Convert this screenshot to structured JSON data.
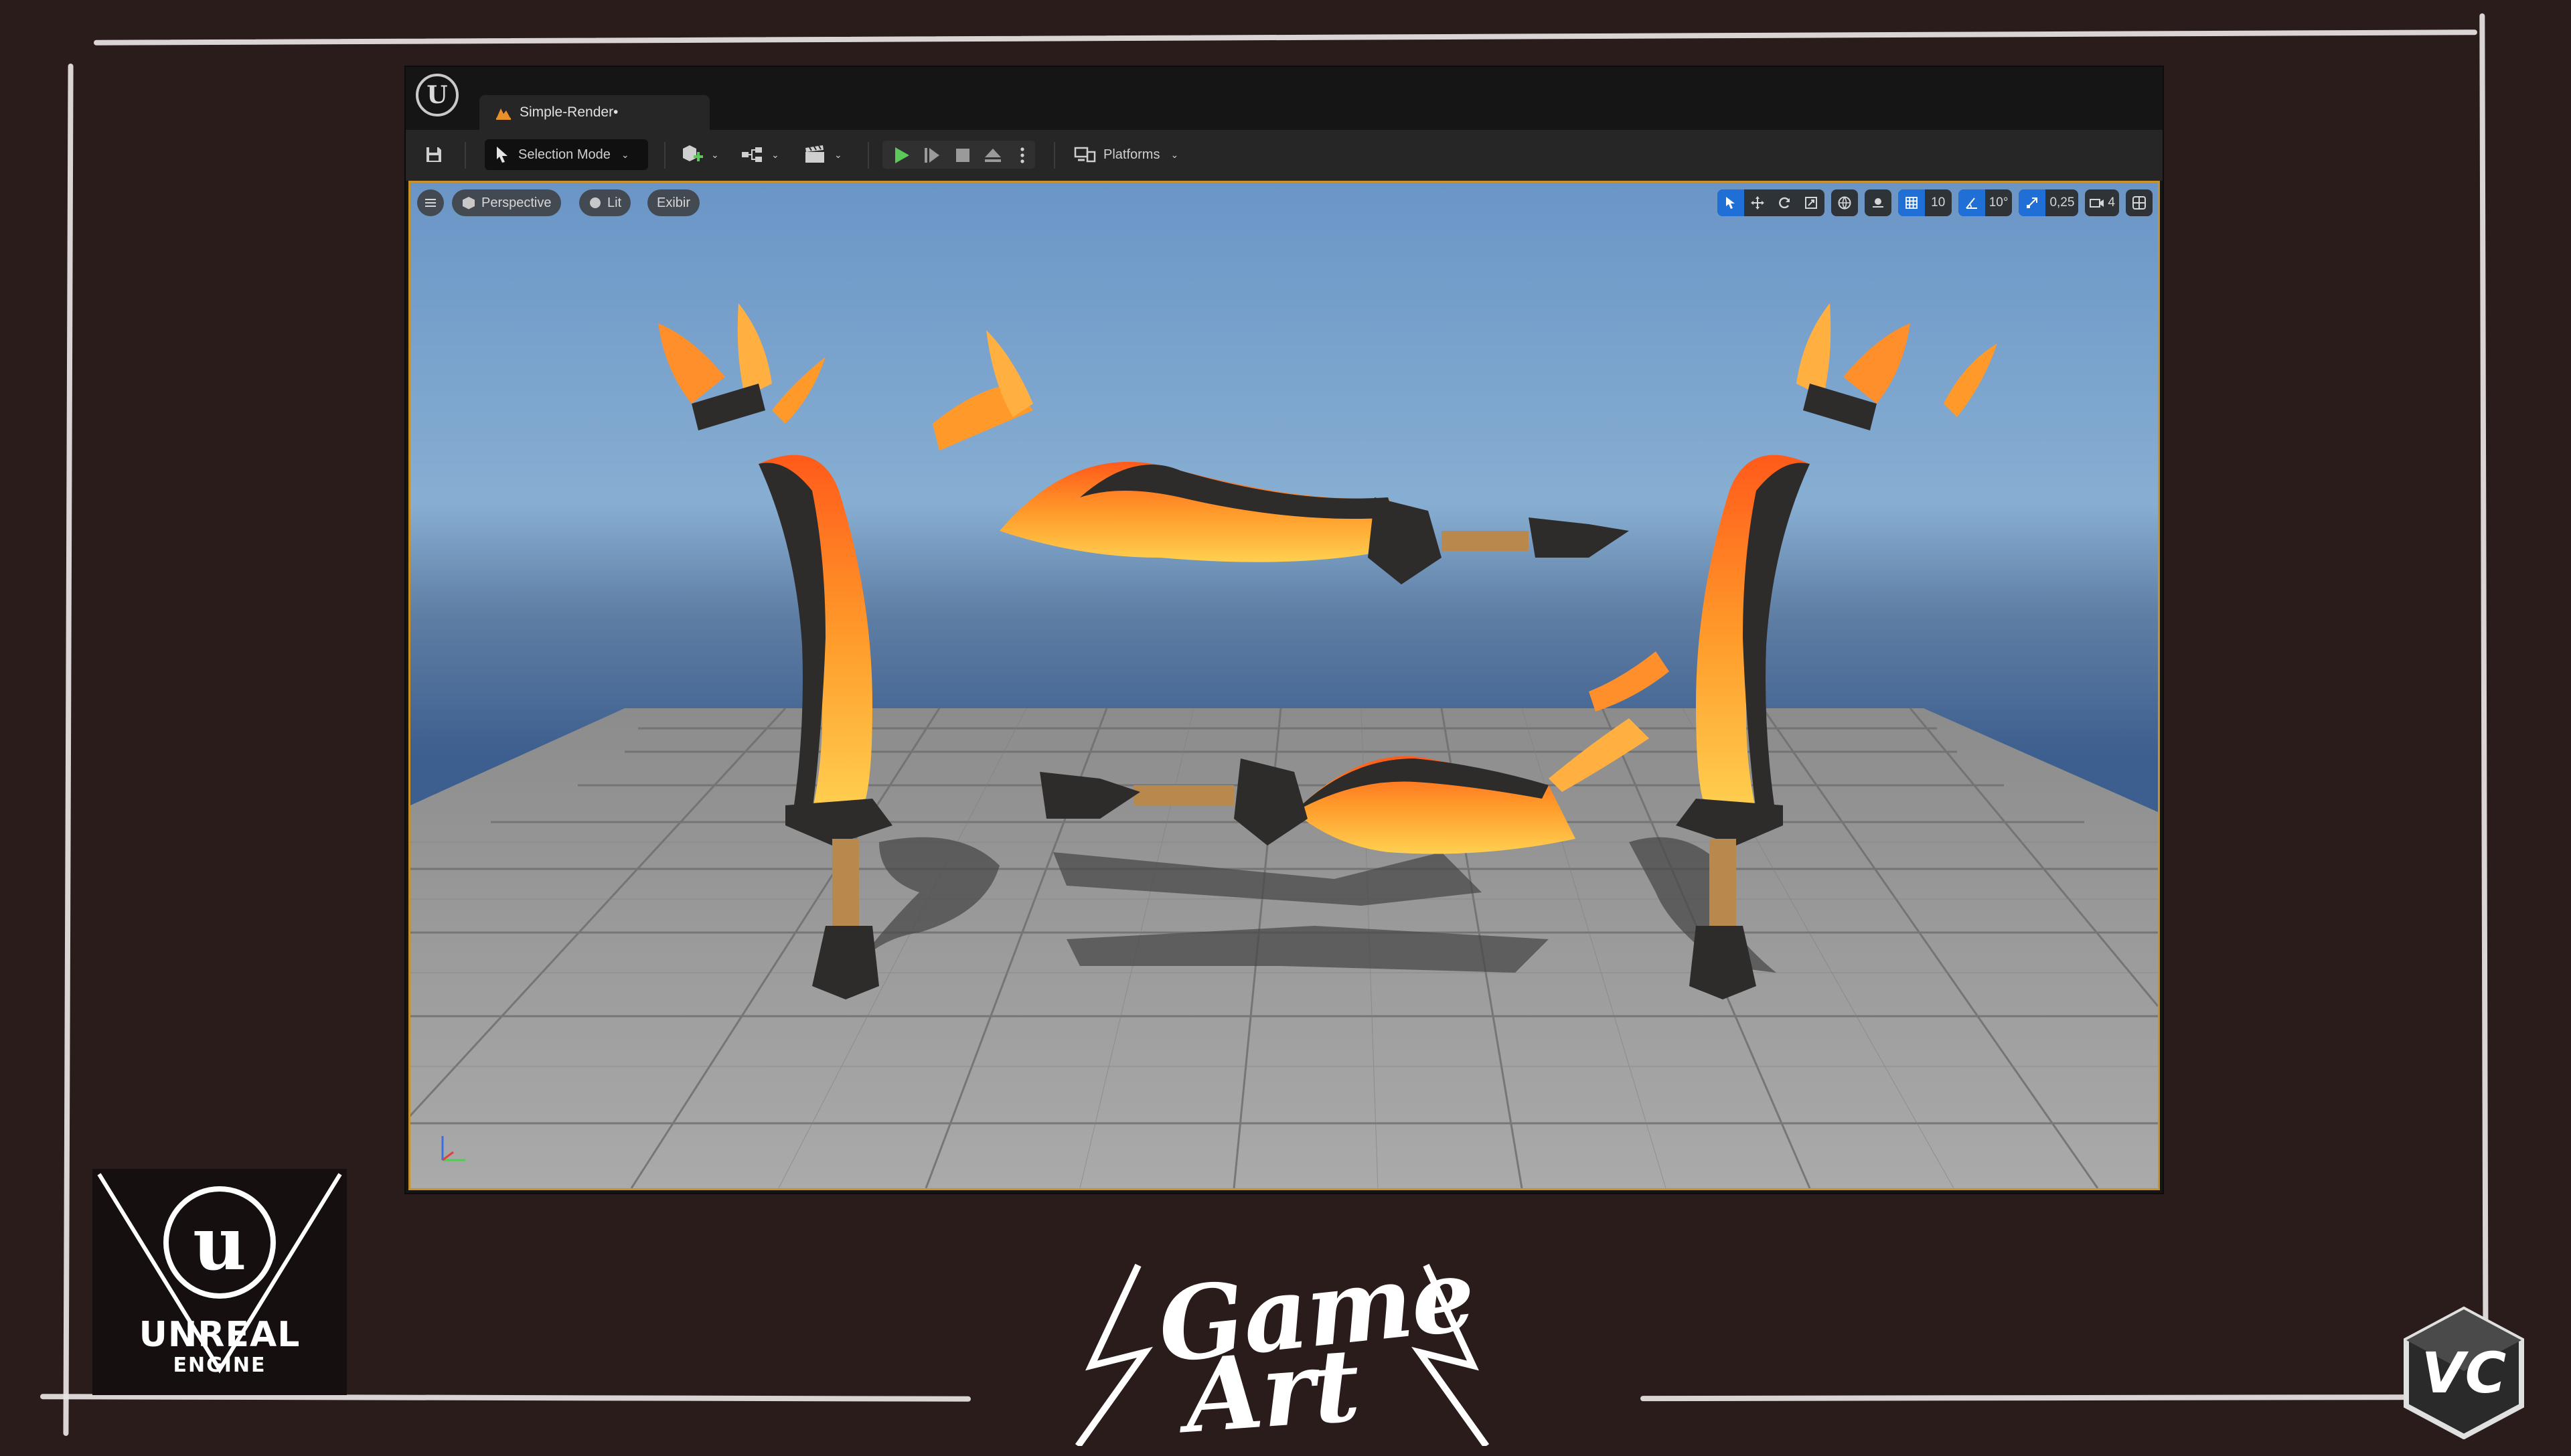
{
  "editor": {
    "logo_glyph": "U",
    "document_tab": "Simple-Render•",
    "toolbar": {
      "selection_mode": "Selection Mode",
      "platforms": "Platforms"
    },
    "viewport": {
      "perspective": "Perspective",
      "lit": "Lit",
      "show": "Exibir",
      "grid_snap_value": "10",
      "rotation_snap_value": "10°",
      "scale_snap_value": "0,25",
      "camera_speed_value": "4"
    }
  },
  "branding": {
    "unreal_name": "UNREAL",
    "unreal_sub": "ENGINE",
    "game_art_line1": "Game",
    "game_art_line2": "Art",
    "vc_mark": "VC"
  },
  "colors": {
    "background": "#2b1c1c",
    "accent_orange": "#c9912a",
    "play_green": "#5cc85a",
    "tool_active_blue": "#1f6fd6",
    "blade_orange": "#ff8a1a",
    "blade_dark": "#2e2b2b"
  },
  "icons": {
    "save": "floppy-disk-icon",
    "selection_mode": "cursor-arrow-icon",
    "add_actor": "add-cube-icon",
    "blueprint": "blueprint-icon",
    "cinematics": "clapperboard-icon",
    "play": "play-icon",
    "advance": "frame-advance-icon",
    "stop": "stop-icon",
    "eject": "eject-icon",
    "platforms": "platforms-icon"
  }
}
